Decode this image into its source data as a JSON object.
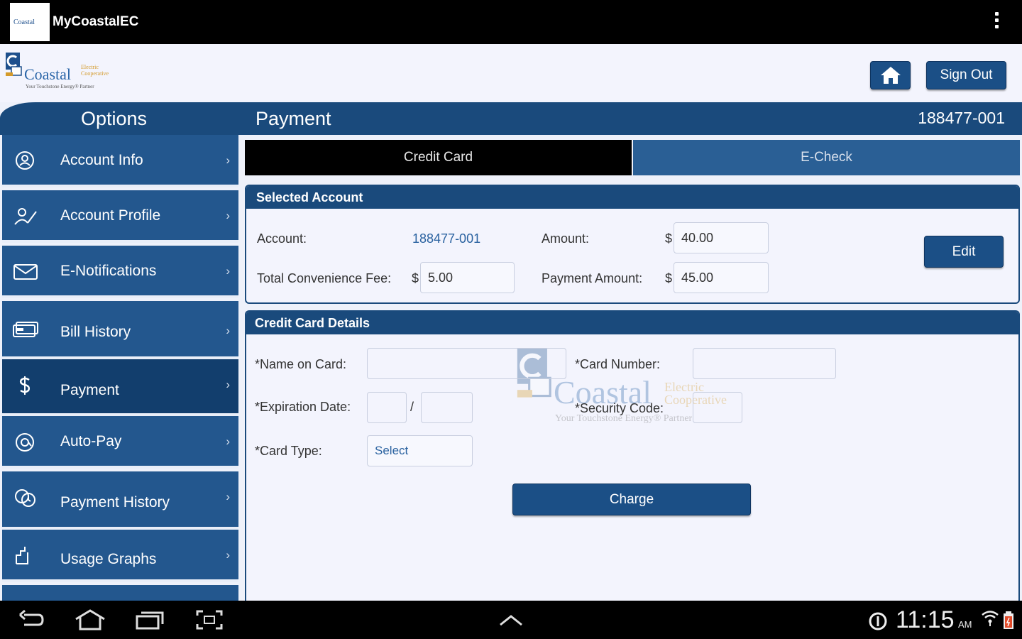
{
  "app": {
    "title": "MyCoastalEC",
    "icon_text": "Coastal"
  },
  "logo": {
    "name": "Coastal",
    "sub_line1": "Electric",
    "sub_line2": "Cooperative",
    "tagline": "Your Touchstone Energy® Partner"
  },
  "header": {
    "home_icon": "home-icon",
    "sign_out_label": "Sign Out"
  },
  "sidebar": {
    "title": "Options",
    "items": [
      {
        "label": "Account Info",
        "icon": "user-circle-icon"
      },
      {
        "label": "Account Profile",
        "icon": "profile-edit-icon"
      },
      {
        "label": "E-Notifications",
        "icon": "envelope-icon"
      },
      {
        "label": "Bill History",
        "icon": "bill-icon"
      },
      {
        "label": "Payment",
        "icon": "dollar-icon",
        "active": true
      },
      {
        "label": "Auto-Pay",
        "icon": "autopay-icon"
      },
      {
        "label": "Payment History",
        "icon": "payment-history-icon"
      },
      {
        "label": "Usage Graphs",
        "icon": "graph-icon"
      }
    ]
  },
  "main": {
    "title": "Payment",
    "account_number": "188477-001",
    "tabs": [
      {
        "label": "Credit Card",
        "active": true
      },
      {
        "label": "E-Check",
        "active": false
      }
    ],
    "selected_account": {
      "title": "Selected Account",
      "account_label": "Account:",
      "account_value": "188477-001",
      "amount_label": "Amount:",
      "amount_currency": "$",
      "amount_value": "40.00",
      "fee_label": "Total Convenience Fee:",
      "fee_currency": "$",
      "fee_value": "5.00",
      "payment_amount_label": "Payment Amount:",
      "payment_currency": "$",
      "payment_amount_value": "45.00",
      "edit_label": "Edit"
    },
    "credit_card": {
      "title": "Credit Card Details",
      "name_label": "*Name on Card:",
      "name_value": "",
      "card_number_label": "*Card Number:",
      "card_number_value": "",
      "expiration_label": "*Expiration Date:",
      "expiration_separator": "/",
      "expiration_month": "",
      "expiration_year": "",
      "security_label": "*Security Code:",
      "security_value": "",
      "card_type_label": "*Card Type:",
      "card_type_value": "Select",
      "charge_label": "Charge"
    }
  },
  "statusbar": {
    "time": "11:15",
    "ampm": "AM"
  },
  "colors": {
    "primary": "#1a4a7c",
    "active_item": "#123e6d",
    "item": "#23578e",
    "background": "#eef1fa"
  }
}
